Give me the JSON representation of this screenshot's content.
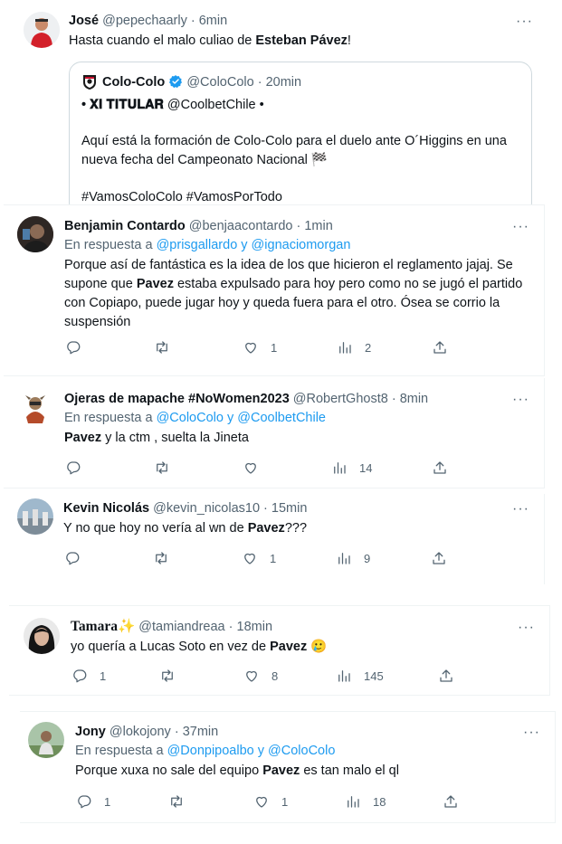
{
  "tweets": [
    {
      "name": "José",
      "handle": "@pepechaarly",
      "time": "6min",
      "text_before": "Hasta cuando el malo culiao de ",
      "text_bold": "Esteban Pávez",
      "text_after": "!",
      "quote": {
        "name": "Colo-Colo",
        "handle": "@ColoColo",
        "time": "20min",
        "line1_bold": "• 𝐗𝐈 𝐓𝐈𝐓𝐔𝐋𝐀𝐑",
        "line1_rest": " @CoolbetChile  •",
        "line2": "Aquí está la formación de Colo-Colo para el duelo ante O´Higgins en una nueva fecha del Campeonato Nacional 🏁",
        "line3": "#VamosColoColo #VamosPorTodo"
      }
    },
    {
      "name": "Benjamin Contardo",
      "handle": "@benjaacontardo",
      "time": "1min",
      "reply_prefix": "En respuesta a ",
      "reply_to": "@prisgallardo y @ignaciomorgan",
      "text_before": "Porque así de fantástica es la idea de los que hicieron el reglamento jajaj. Se supone que ",
      "text_bold": "Pavez",
      "text_after": " estaba expulsado para hoy pero como no se jugó el partido con Copiapo, puede jugar hoy y queda fuera para el otro. Ósea se corrio la suspensión",
      "stats": {
        "replies": "",
        "retweets": "",
        "likes": "1",
        "views": "2"
      }
    },
    {
      "name": "Ojeras de mapache #NoWomen2023",
      "handle": "@RobertGhost8",
      "time": "8min",
      "reply_prefix": "En respuesta a ",
      "reply_to": "@ColoColo y @CoolbetChile",
      "text_before": "",
      "text_bold": "Pavez",
      "text_after": " y la ctm , suelta la Jineta",
      "stats": {
        "replies": "",
        "retweets": "",
        "likes": "",
        "views": "14"
      }
    },
    {
      "name": "Kevin Nicolás",
      "handle": "@kevin_nicolas10",
      "time": "15min",
      "text_before": "Y no que hoy no vería al wn de ",
      "text_bold": "Pavez",
      "text_after": "???",
      "stats": {
        "replies": "",
        "retweets": "",
        "likes": "1",
        "views": "9"
      }
    },
    {
      "name": "Tamara✨",
      "handle": "@tamiandreaa",
      "time": "18min",
      "text_before": "yo quería a Lucas Soto en vez de ",
      "text_bold": "Pavez",
      "text_after": " 🥲",
      "stats": {
        "replies": "1",
        "retweets": "",
        "likes": "8",
        "views": "145"
      }
    },
    {
      "name": "Jony",
      "handle": "@lokojony",
      "time": "37min",
      "reply_prefix": "En respuesta a ",
      "reply_to": "@Donpipoalbo y @ColoColo",
      "text_before": "Porque xuxa no sale del equipo ",
      "text_bold": "Pavez",
      "text_after": " es tan malo el ql",
      "stats": {
        "replies": "1",
        "retweets": "",
        "likes": "1",
        "views": "18"
      }
    }
  ],
  "ui": {
    "separator": " · ",
    "more": "···"
  },
  "colors": {
    "accent": "#1d9bf0",
    "muted": "#536471",
    "text": "#0f1419",
    "border": "#cfd9de"
  }
}
